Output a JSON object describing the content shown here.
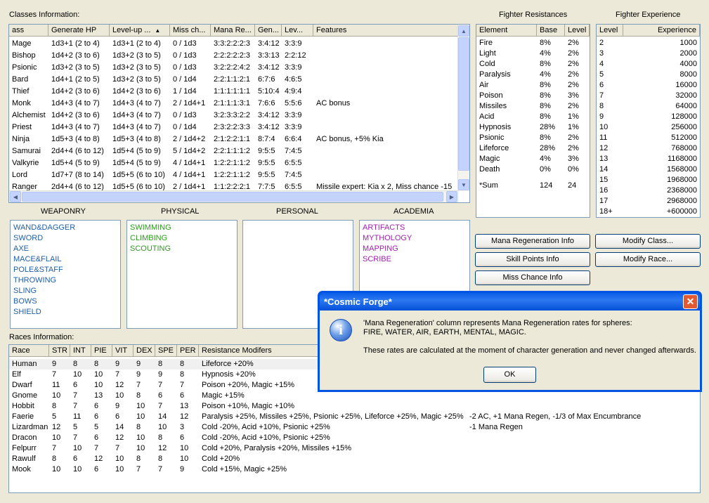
{
  "classes_label": "Classes Information:",
  "class_columns": [
    "ass",
    "Generate HP",
    "Level-up ...",
    "Miss ch...",
    "Mana Re...",
    "Gen...",
    "Lev...",
    "Features"
  ],
  "classes": [
    [
      "Mage",
      "1d3+1 (2 to 4)",
      "1d3+1 (2 to 4)",
      "0 / 1d3",
      "3:3:2:2:2:3",
      "3:4:12",
      "3:3:9",
      ""
    ],
    [
      "Bishop",
      "1d4+2 (3 to 6)",
      "1d3+2 (3 to 5)",
      "0 / 1d3",
      "2:2:2:2:2:3",
      "3:3:13",
      "2:2:12",
      ""
    ],
    [
      "Psionic",
      "1d3+2 (3 to 5)",
      "1d3+2 (3 to 5)",
      "0 / 1d3",
      "3:2:2:2:4:2",
      "3:4:12",
      "3:3:9",
      ""
    ],
    [
      "Bard",
      "1d4+1 (2 to 5)",
      "1d3+2 (3 to 5)",
      "0 / 1d4",
      "2:2:1:1:2:1",
      "6:7:6",
      "4:6:5",
      ""
    ],
    [
      "Thief",
      "1d4+2 (3 to 6)",
      "1d4+2 (3 to 6)",
      "1 / 1d4",
      "1:1:1:1:1:1",
      "5:10:4",
      "4:9:4",
      ""
    ],
    [
      "Monk",
      "1d4+3 (4 to 7)",
      "1d4+3 (4 to 7)",
      "2 / 1d4+1",
      "2:1:1:1:3:1",
      "7:6:6",
      "5:5:6",
      "AC bonus"
    ],
    [
      "Alchemist",
      "1d4+2 (3 to 6)",
      "1d4+3 (4 to 7)",
      "0 / 1d3",
      "3:2:3:3:2:2",
      "3:4:12",
      "3:3:9",
      ""
    ],
    [
      "Priest",
      "1d4+3 (4 to 7)",
      "1d4+3 (4 to 7)",
      "0 / 1d4",
      "2:3:2:2:3:3",
      "3:4:12",
      "3:3:9",
      ""
    ],
    [
      "Ninja",
      "1d5+3 (4 to 8)",
      "1d5+3 (4 to 8)",
      "2 / 1d4+2",
      "2:1:2:2:1:1",
      "8:7:4",
      "6:6:4",
      "AC bonus, +5% Kia"
    ],
    [
      "Samurai",
      "2d4+4 (6 to 12)",
      "1d5+4 (5 to 9)",
      "5 / 1d4+2",
      "2:2:1:1:1:2",
      "9:5:5",
      "7:4:5",
      ""
    ],
    [
      "Valkyrie",
      "1d5+4 (5 to 9)",
      "1d5+4 (5 to 9)",
      "4 / 1d4+1",
      "1:2:2:1:1:2",
      "9:5:5",
      "6:5:5",
      ""
    ],
    [
      "Lord",
      "1d7+7 (8 to 14)",
      "1d5+5 (6 to 10)",
      "4 / 1d4+1",
      "1:2:2:1:1:2",
      "9:5:5",
      "7:4:5",
      ""
    ],
    [
      "Ranger",
      "2d4+4 (6 to 12)",
      "1d5+5 (6 to 10)",
      "2 / 1d4+1",
      "1:1:2:2:2:1",
      "7:7:5",
      "6:5:5",
      "Missile expert: Kia x 2, Miss chance -15"
    ]
  ],
  "fighter_resist_label": "Fighter Resistances",
  "resist_columns": [
    "Element",
    "Base",
    "Level"
  ],
  "resistances": [
    [
      "Fire",
      "8%",
      "2%"
    ],
    [
      "Light",
      "4%",
      "2%"
    ],
    [
      "Cold",
      "8%",
      "2%"
    ],
    [
      "Paralysis",
      "4%",
      "2%"
    ],
    [
      "Air",
      "8%",
      "2%"
    ],
    [
      "Poison",
      "8%",
      "3%"
    ],
    [
      "Missiles",
      "8%",
      "2%"
    ],
    [
      "Acid",
      "8%",
      "1%"
    ],
    [
      "Hypnosis",
      "28%",
      "1%"
    ],
    [
      "Psionic",
      "8%",
      "2%"
    ],
    [
      "Lifeforce",
      "28%",
      "2%"
    ],
    [
      "Magic",
      "4%",
      "3%"
    ],
    [
      "Death",
      "0%",
      "0%"
    ]
  ],
  "resist_sum": [
    "*Sum",
    "124",
    "24"
  ],
  "fighter_exp_label": "Fighter Experience",
  "exp_columns": [
    "Level",
    "Experience"
  ],
  "experience": [
    [
      "2",
      "1000"
    ],
    [
      "3",
      "2000"
    ],
    [
      "4",
      "4000"
    ],
    [
      "5",
      "8000"
    ],
    [
      "6",
      "16000"
    ],
    [
      "7",
      "32000"
    ],
    [
      "8",
      "64000"
    ],
    [
      "9",
      "128000"
    ],
    [
      "10",
      "256000"
    ],
    [
      "11",
      "512000"
    ],
    [
      "12",
      "768000"
    ],
    [
      "13",
      "1168000"
    ],
    [
      "14",
      "1568000"
    ],
    [
      "15",
      "1968000"
    ],
    [
      "16",
      "2368000"
    ],
    [
      "17",
      "2968000"
    ],
    [
      "18+",
      "+600000"
    ]
  ],
  "skill_groups": {
    "weaponry": {
      "label": "WEAPONRY",
      "items": [
        "WAND&DAGGER",
        "SWORD",
        "AXE",
        "MACE&FLAIL",
        "POLE&STAFF",
        "THROWING",
        "SLING",
        "BOWS",
        "SHIELD"
      ]
    },
    "physical": {
      "label": "PHYSICAL",
      "items": [
        "SWIMMING",
        "CLIMBING",
        "SCOUTING"
      ]
    },
    "personal": {
      "label": "PERSONAL",
      "items": []
    },
    "academia": {
      "label": "ACADEMIA",
      "items": [
        "ARTIFACTS",
        "MYTHOLOGY",
        "MAPPING",
        "SCRIBE"
      ]
    }
  },
  "buttons": {
    "mana": "Mana Regeneration Info",
    "skill": "Skill Points Info",
    "miss": "Miss Chance Info",
    "modclass": "Modify Class...",
    "modrace": "Modify Race..."
  },
  "races_label": "Races Information:",
  "race_columns": [
    "Race",
    "STR",
    "INT",
    "PIE",
    "VIT",
    "DEX",
    "SPE",
    "PER",
    "Resistance Modifers"
  ],
  "races": [
    [
      "Human",
      "9",
      "8",
      "8",
      "9",
      "9",
      "8",
      "8",
      "Lifeforce +20%",
      ""
    ],
    [
      "Elf",
      "7",
      "10",
      "10",
      "7",
      "9",
      "9",
      "8",
      "Hypnosis +20%",
      ""
    ],
    [
      "Dwarf",
      "11",
      "6",
      "10",
      "12",
      "7",
      "7",
      "7",
      "Poison +20%, Magic +15%",
      ""
    ],
    [
      "Gnome",
      "10",
      "7",
      "13",
      "10",
      "8",
      "6",
      "6",
      "Magic +15%",
      ""
    ],
    [
      "Hobbit",
      "8",
      "7",
      "6",
      "9",
      "10",
      "7",
      "13",
      "Poison +10%, Magic +10%",
      ""
    ],
    [
      "Faerie",
      "5",
      "11",
      "6",
      "6",
      "10",
      "14",
      "12",
      "Paralysis +25%, Missiles +25%, Psionic +25%, Lifeforce +25%, Magic +25%",
      "-2 AC, +1 Mana Regen, -1/3 of Max Encumbrance"
    ],
    [
      "Lizardman",
      "12",
      "5",
      "5",
      "14",
      "8",
      "10",
      "3",
      "Cold -20%, Acid +10%, Psionic +25%",
      "-1 Mana Regen"
    ],
    [
      "Dracon",
      "10",
      "7",
      "6",
      "12",
      "10",
      "8",
      "6",
      "Cold -20%, Acid +10%, Psionic +25%",
      ""
    ],
    [
      "Felpurr",
      "7",
      "10",
      "7",
      "7",
      "10",
      "12",
      "10",
      "Cold +20%, Paralysis +20%, Missiles +15%",
      ""
    ],
    [
      "Rawulf",
      "8",
      "6",
      "12",
      "10",
      "8",
      "8",
      "10",
      "Cold +20%",
      ""
    ],
    [
      "Mook",
      "10",
      "10",
      "6",
      "10",
      "7",
      "7",
      "9",
      "Cold +15%, Magic +25%",
      ""
    ]
  ],
  "dialog": {
    "title": "*Cosmic Forge*",
    "line1": "'Mana Regeneration' column represents Mana Regeneration rates for spheres:",
    "line2": "FIRE, WATER, AIR, EARTH, MENTAL, MAGIC.",
    "line3": "These rates are calculated at the moment of character generation and never changed afterwards.",
    "ok": "OK",
    "close_glyph": "✕",
    "info_glyph": "i"
  },
  "colors": {
    "weaponry": "#1f5ea8",
    "physical": "#2f9a1f",
    "academia": "#a020b0"
  }
}
